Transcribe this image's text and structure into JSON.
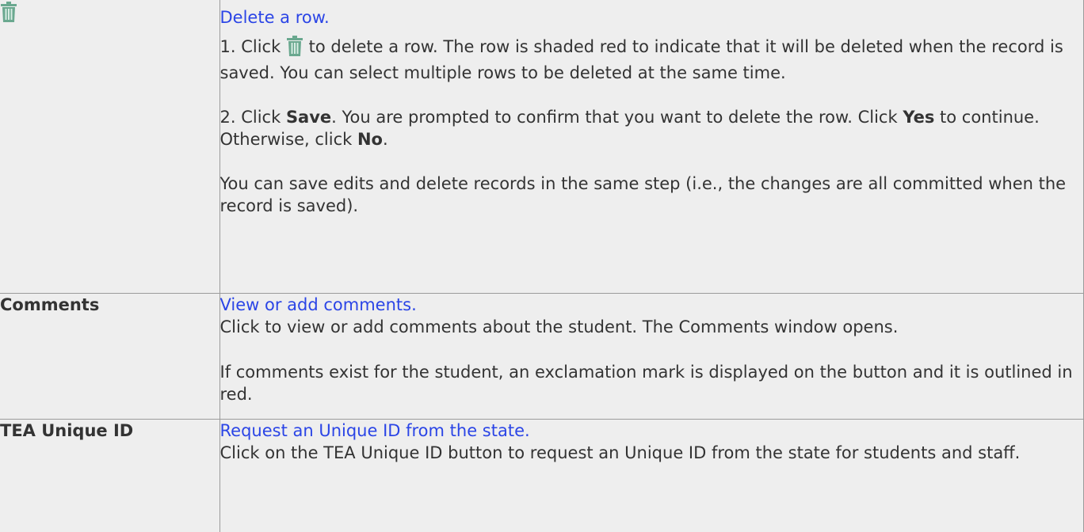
{
  "rows": [
    {
      "label": "",
      "icon": "trash-icon",
      "link": "Delete a row.",
      "step1_before": "1. Click ",
      "step1_after": " to delete a row. The row is shaded red to indicate that it will be deleted when the record is saved. You can select multiple rows to be deleted at the same time.",
      "step2_a": "2. Click ",
      "step2_save": "Save",
      "step2_b": ". You are prompted to confirm that you want to delete the row. Click ",
      "step2_yes": "Yes",
      "step2_c": " to continue. Otherwise, click ",
      "step2_no": "No",
      "step2_d": ".",
      "note": "You can save edits and delete records in the same step (i.e., the changes are all committed when the record is saved)."
    },
    {
      "label": "Comments",
      "link": "View or add comments.",
      "desc": "Click to view or add comments about the student. The Comments window opens.",
      "note": "If comments exist for the student, an exclamation mark is displayed on the button and it is outlined in red."
    },
    {
      "label": "TEA Unique ID",
      "link": "Request an Unique ID from the state.",
      "desc": "Click on the TEA Unique ID button to request an Unique ID from the state for students and staff."
    }
  ],
  "colors": {
    "link": "#2b45e6",
    "text": "#333333",
    "cell_bg": "#eeeeee",
    "border": "#9b9b9b",
    "icon": "#6aa88f"
  }
}
